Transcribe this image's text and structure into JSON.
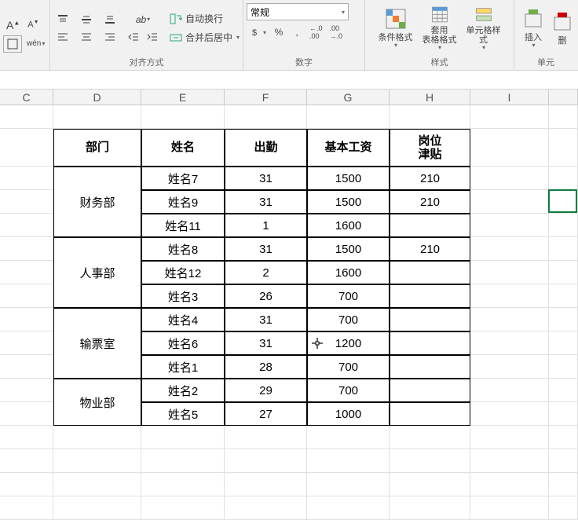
{
  "ribbon": {
    "font": {
      "grow": "A",
      "shrink": "A"
    },
    "wen": "wén",
    "wrap_text": "自动换行",
    "merge_center": "合并后居中",
    "align_group_label": "对齐方式",
    "number_format": "常规",
    "percent": "%",
    "comma": ",",
    "inc_dec": ".0",
    "dec_inc": ".00",
    "number_group_label": "数字",
    "cond_format": "条件格式",
    "table_format_l1": "套用",
    "table_format_l2": "表格格式",
    "cell_style": "单元格样式",
    "style_group_label": "样式",
    "insert": "插入",
    "delete": "删",
    "cell_group_label": "单元"
  },
  "columns": {
    "C": "C",
    "D": "D",
    "E": "E",
    "F": "F",
    "G": "G",
    "H": "H",
    "I": "I"
  },
  "table": {
    "headers": {
      "dept": "部门",
      "name": "姓名",
      "attend": "出勤",
      "base": "基本工资",
      "allow_l1": "岗位",
      "allow_l2": "津贴"
    },
    "groups": [
      {
        "dept": "财务部",
        "rows": [
          {
            "name": "姓名7",
            "attend": "31",
            "base": "1500",
            "allow": "210"
          },
          {
            "name": "姓名9",
            "attend": "31",
            "base": "1500",
            "allow": "210"
          },
          {
            "name": "姓名11",
            "attend": "1",
            "base": "1600",
            "allow": ""
          }
        ]
      },
      {
        "dept": "人事部",
        "rows": [
          {
            "name": "姓名8",
            "attend": "31",
            "base": "1500",
            "allow": "210"
          },
          {
            "name": "姓名12",
            "attend": "2",
            "base": "1600",
            "allow": ""
          },
          {
            "name": "姓名3",
            "attend": "26",
            "base": "700",
            "allow": ""
          }
        ]
      },
      {
        "dept": "输票室",
        "rows": [
          {
            "name": "姓名4",
            "attend": "31",
            "base": "700",
            "allow": ""
          },
          {
            "name": "姓名6",
            "attend": "31",
            "base": "1200",
            "allow": ""
          },
          {
            "name": "姓名1",
            "attend": "28",
            "base": "700",
            "allow": ""
          }
        ]
      },
      {
        "dept": "物业部",
        "rows": [
          {
            "name": "姓名2",
            "attend": "29",
            "base": "700",
            "allow": ""
          },
          {
            "name": "姓名5",
            "attend": "27",
            "base": "1000",
            "allow": ""
          }
        ]
      }
    ]
  }
}
